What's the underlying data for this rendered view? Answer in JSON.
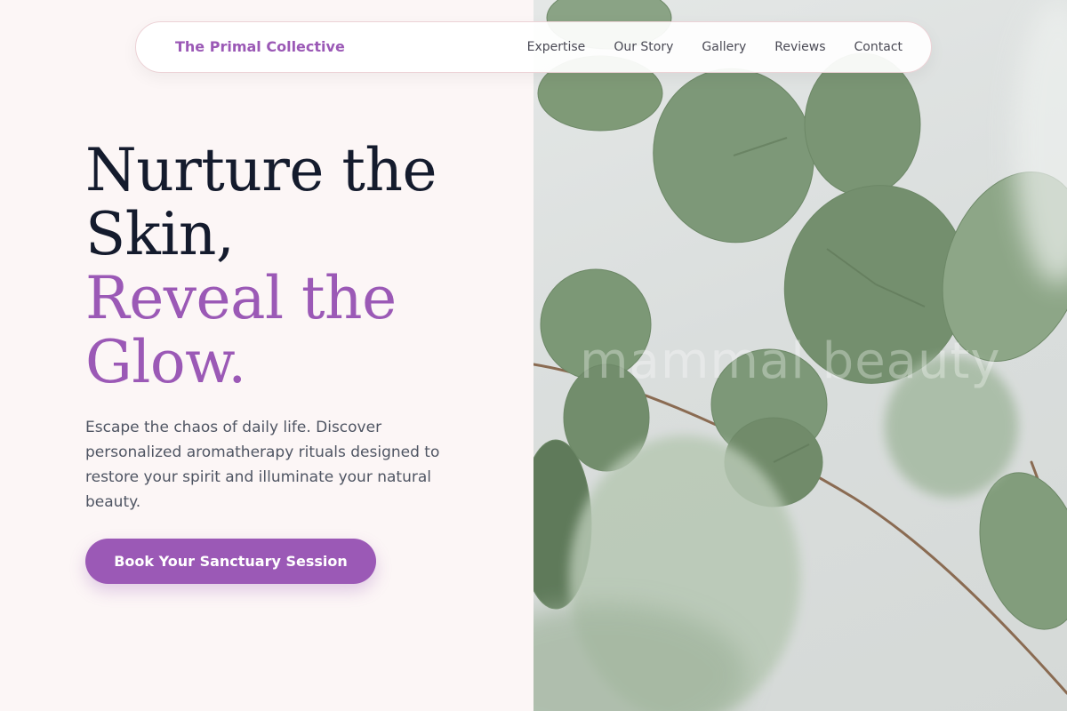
{
  "nav": {
    "brand": "The Primal Collective",
    "links": [
      "Expertise",
      "Our Story",
      "Gallery",
      "Reviews",
      "Contact"
    ]
  },
  "hero": {
    "headline_dark": "Nurture the Skin,",
    "headline_accent": "Reveal the Glow.",
    "description": "Escape the chaos of daily life. Discover personalized aromatherapy rituals designed to restore your spirit and illuminate your natural beauty.",
    "cta_label": "Book Your Sanctuary Session"
  },
  "image": {
    "watermark": "mammal beauty",
    "subject": "eucalyptus-leaves-photo"
  },
  "colors": {
    "accent": "#9b59b6",
    "heading": "#141b2d",
    "body_text": "#4f5563",
    "background": "#fcf6f6",
    "leaf": "#7f9a77"
  }
}
